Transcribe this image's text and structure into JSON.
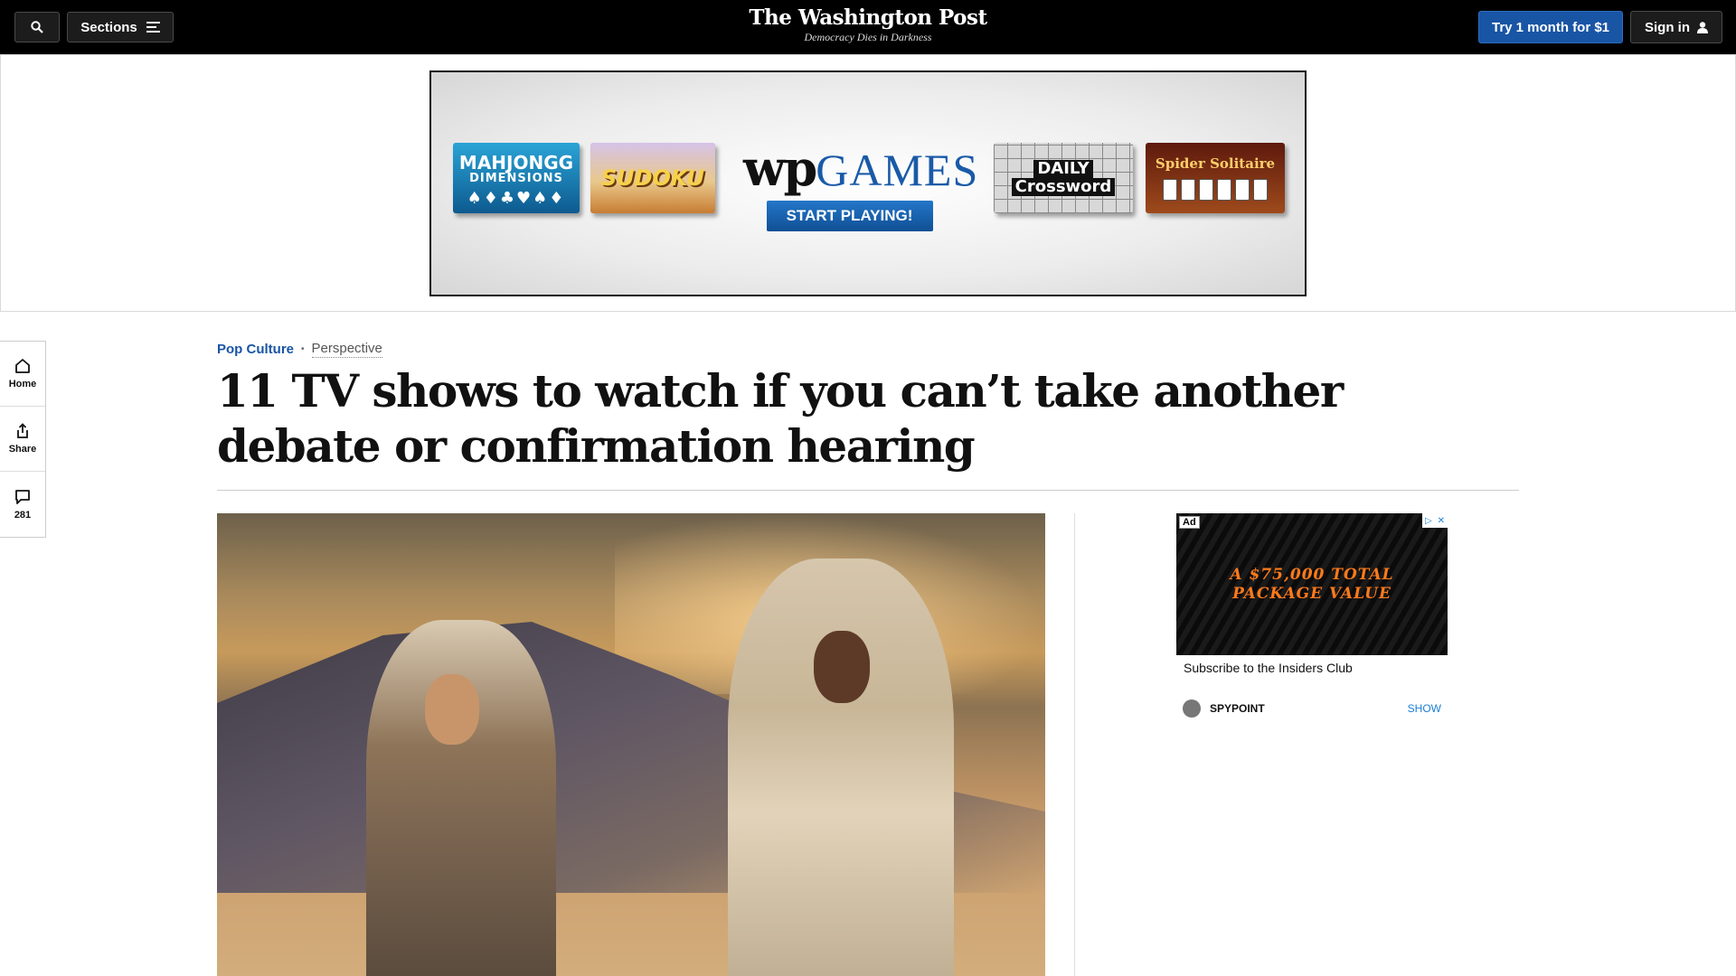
{
  "topbar": {
    "sections_label": "Sections",
    "masthead_title": "The Washington Post",
    "masthead_tagline": "Democracy Dies in Darkness",
    "subscribe_label": "Try 1 month for $1",
    "signin_label": "Sign in"
  },
  "top_ad": {
    "tiles": {
      "mahjong_line1": "MAHJONGG",
      "mahjong_line2": "DIMENSIONS",
      "sudoku": "SUDOKU",
      "crossword_line1": "DAILY",
      "crossword_line2": "Crossword",
      "spider": "Spider Solitaire"
    },
    "logo_wp": "wp",
    "logo_games": "GAMES",
    "cta": "START PLAYING!"
  },
  "rail": {
    "home_label": "Home",
    "share_label": "Share",
    "comments_count": "281"
  },
  "article": {
    "category": "Pop Culture",
    "separator": "•",
    "label": "Perspective",
    "headline": "11 TV shows to watch if you can’t take another debate or confirmation hearing"
  },
  "side_ad": {
    "ad_badge": "Ad",
    "banner_line1": "A $75,000 TOTAL",
    "banner_line2": "PACKAGE VALUE",
    "caption": "Subscribe to the Insiders Club",
    "advertiser": "SPYPOINT",
    "show_label": "SHOW"
  },
  "colors": {
    "brand_blue": "#1955a5",
    "topbar_bg": "#000000",
    "ad_orange": "#ff7a1a"
  },
  "icons": [
    "search-icon",
    "menu-icon",
    "user-icon",
    "home-icon",
    "share-icon",
    "comment-icon",
    "globe-icon",
    "adchoices-icon",
    "close-icon"
  ]
}
